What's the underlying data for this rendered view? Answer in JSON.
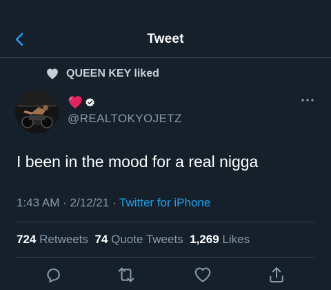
{
  "header": {
    "title": "Tweet",
    "back_icon": "chevron-left-icon"
  },
  "social_context": {
    "text": "QUEEN KEY liked",
    "icon": "heart-icon"
  },
  "author": {
    "display_name_emoji": "red-heart-emoji",
    "verified_icon": "verified-badge-icon",
    "handle": "@REALTOKYOJETZ"
  },
  "tweet": {
    "text": "I been in the mood for a real nigga",
    "time": "1:43 AM",
    "date": "2/12/21",
    "source": "Twitter for iPhone"
  },
  "stats": {
    "retweets_count": "724",
    "retweets_label": "Retweets",
    "quotes_count": "74",
    "quotes_label": "Quote Tweets",
    "likes_count": "1,269",
    "likes_label": "Likes"
  },
  "actions": [
    "reply-icon",
    "retweet-icon",
    "like-icon",
    "share-icon"
  ],
  "colors": {
    "background": "#15202b",
    "accent": "#1da1f2",
    "secondary_text": "#8899a6",
    "divider": "#38444d"
  }
}
